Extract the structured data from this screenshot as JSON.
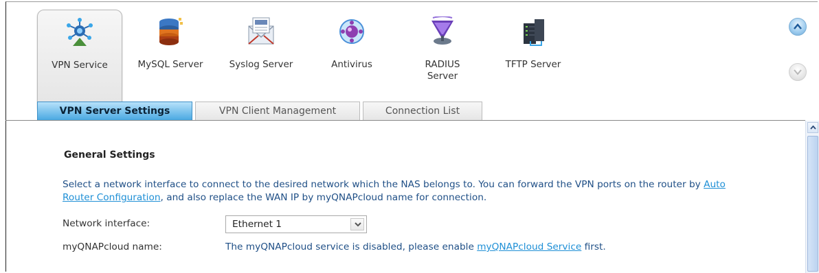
{
  "apps": [
    {
      "label": "VPN Service",
      "icon": "vpn-icon",
      "selected": true
    },
    {
      "label": "MySQL Server",
      "icon": "mysql-icon",
      "selected": false
    },
    {
      "label": "Syslog Server",
      "icon": "syslog-icon",
      "selected": false
    },
    {
      "label": "Antivirus",
      "icon": "antivirus-icon",
      "selected": false
    },
    {
      "label": "RADIUS\nServer",
      "icon": "radius-icon",
      "selected": false
    },
    {
      "label": "TFTP Server",
      "icon": "tftp-icon",
      "selected": false
    }
  ],
  "tabs": [
    {
      "label": "VPN Server Settings",
      "active": true
    },
    {
      "label": "VPN Client Management",
      "active": false
    },
    {
      "label": "Connection List",
      "active": false
    }
  ],
  "general": {
    "title": "General Settings",
    "desc_part1": "Select a network interface to connect to the desired network which the NAS belongs to. You can forward the VPN ports on the router by ",
    "desc_link": "Auto Router Configuration",
    "desc_part2": ", and also replace the WAN IP by myQNAPcloud name for connection."
  },
  "network_interface": {
    "label": "Network interface:",
    "value": "Ethernet 1"
  },
  "myqnapcloud": {
    "label": "myQNAPcloud name:",
    "text_part1": "The myQNAPcloud service is disabled, please enable ",
    "link": "myQNAPcloud Service",
    "text_part2": " first."
  },
  "colors": {
    "accent": "#4aa9e2",
    "text_blue": "#1f4f86",
    "link": "#1e8fd6"
  }
}
